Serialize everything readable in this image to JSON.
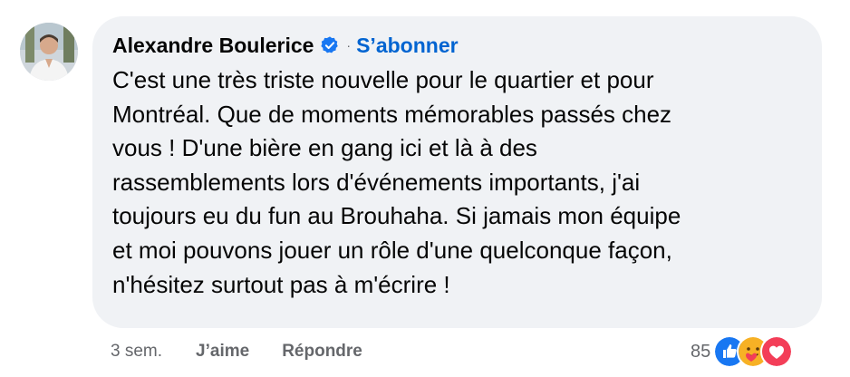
{
  "comment": {
    "author": "Alexandre Boulerice",
    "separator": "·",
    "follow_label": "S’abonner",
    "text": "C'est une très triste nouvelle pour le quartier et pour\nMontréal. Que de moments mémorables passés chez\nvous ! D'une bière en gang ici et là à des\nrassemblements lors d'événements importants, j'ai\ntoujours eu du fun au Brouhaha. Si jamais mon équipe\net moi pouvons jouer un rôle d'une quelconque façon,\nn'hésitez surtout pas à m'écrire !"
  },
  "actions": {
    "time": "3 sem.",
    "like_label": "J’aime",
    "reply_label": "Répondre"
  },
  "reactions": {
    "count": "85",
    "icons": [
      "like-icon",
      "care-icon",
      "love-icon"
    ]
  },
  "colors": {
    "bubble": "#f0f2f5",
    "link": "#0064d1",
    "muted": "#65676b",
    "like": "#1877f2",
    "love": "#f33e58",
    "care": "#f7b125"
  }
}
